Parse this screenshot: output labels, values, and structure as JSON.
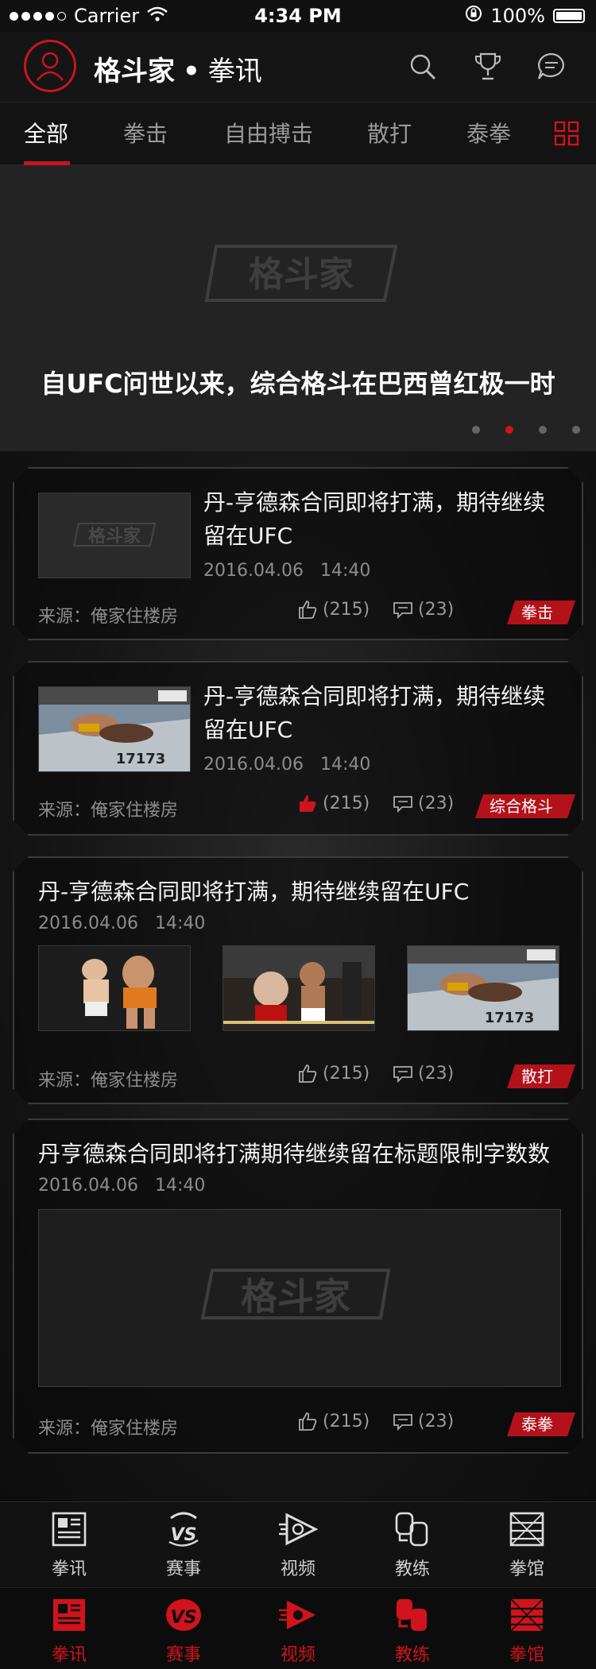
{
  "status_bar": {
    "carrier": "Carrier",
    "time": "4:34 PM",
    "battery": "100%"
  },
  "header": {
    "title": "格斗家",
    "separator": "•",
    "subtitle": "拳讯"
  },
  "tabs": [
    "全部",
    "拳击",
    "自由搏击",
    "散打",
    "泰拳"
  ],
  "active_tab": 0,
  "banner": {
    "logo_text": "格斗家",
    "title": "自UFC问世以来，综合格斗在巴西曾红极一时",
    "page_count": 4,
    "active_page": 1
  },
  "articles": [
    {
      "title": "丹-亨德森合同即将打满，期待继续留在UFC",
      "date": "2016.04.06",
      "time": "14:40",
      "source": "来源：俺家住楼房",
      "likes": "(215)",
      "comments": "(23)",
      "tag": "拳击",
      "liked": false,
      "thumb": "placeholder-logo"
    },
    {
      "title": "丹-亨德森合同即将打满，期待继续留在UFC",
      "date": "2016.04.06",
      "time": "14:40",
      "source": "来源：俺家住楼房",
      "likes": "(215)",
      "comments": "(23)",
      "tag": "综合格斗",
      "liked": true,
      "thumb": "photo-ground-fight"
    },
    {
      "title": "丹-亨德森合同即将打满，期待继续留在UFC",
      "date": "2016.04.06",
      "time": "14:40",
      "source": "来源：俺家住楼房",
      "likes": "(215)",
      "comments": "(23)",
      "tag": "散打",
      "liked": false,
      "images": [
        "photo-kickboxing",
        "photo-ring-punch",
        "photo-ground-fight"
      ]
    },
    {
      "title": "丹亨德森合同即将打满期待继续留在标题限制字数数",
      "date": "2016.04.06",
      "time": "14:40",
      "source": "来源：俺家住楼房",
      "likes": "(215)",
      "comments": "(23)",
      "tag": "泰拳",
      "liked": false,
      "image": "placeholder-logo-large"
    }
  ],
  "tab_bar": [
    {
      "label": "拳讯",
      "icon": "news-icon"
    },
    {
      "label": "赛事",
      "icon": "vs-icon"
    },
    {
      "label": "视频",
      "icon": "video-play-icon"
    },
    {
      "label": "教练",
      "icon": "coach-glove-icon"
    },
    {
      "label": "拳馆",
      "icon": "boxing-ring-icon"
    }
  ],
  "colors": {
    "accent": "#c8161e",
    "background": "#0e0e0e",
    "card_border": "#3a3a3a"
  }
}
